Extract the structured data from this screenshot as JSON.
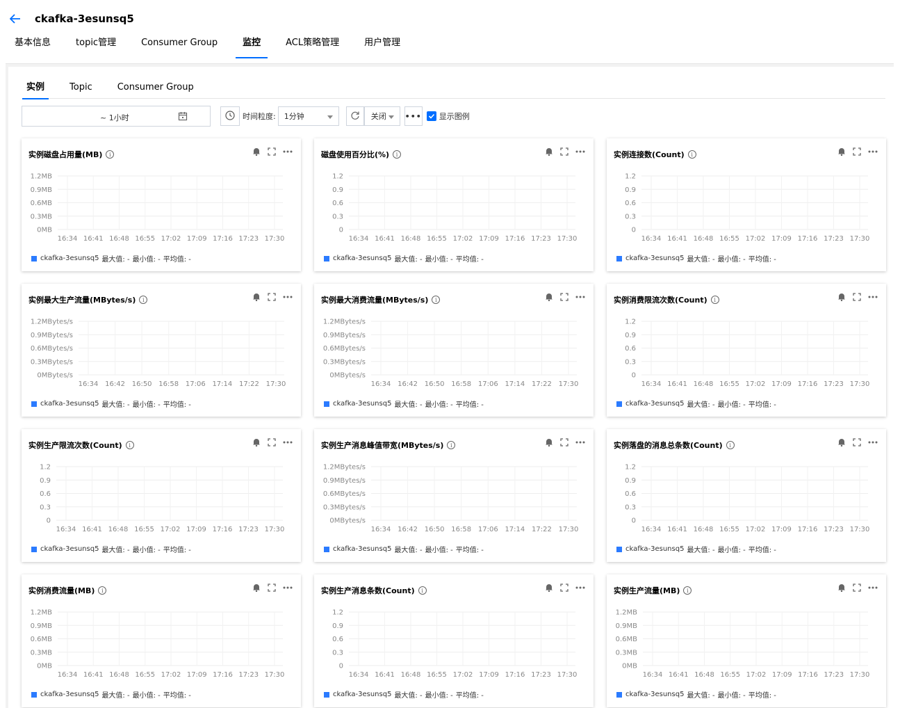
{
  "header": {
    "title": "ckafka-3esunsq5",
    "tabs": [
      "基本信息",
      "topic管理",
      "Consumer Group",
      "监控",
      "ACL策略管理",
      "用户管理"
    ],
    "active_tab": 3
  },
  "sub_tabs": [
    "实例",
    "Topic",
    "Consumer Group"
  ],
  "toolbar": {
    "range_text": "~  1小时",
    "granularity_label": "时间粒度:",
    "granularity_value": "1分钟",
    "refresh_value": "关闭",
    "more": "•••",
    "legend_label": "显示图例"
  },
  "colors": {
    "accent": "#006eff",
    "series": "#2b7bff"
  },
  "legend_stats": {
    "max": "最大值: -",
    "min": "最小值: -",
    "avg": "平均值: -"
  },
  "chart_data": [
    {
      "type": "line",
      "title": "实例磁盘占用量(MB)",
      "y_ticks": [
        "1.2MB",
        "0.9MB",
        "0.6MB",
        "0.3MB",
        "0MB"
      ],
      "x_ticks": [
        "16:34",
        "16:41",
        "16:48",
        "16:55",
        "17:02",
        "17:09",
        "17:16",
        "17:23",
        "17:30"
      ],
      "ylim": [
        0,
        1.2
      ],
      "grid": true,
      "legend": "bottom-left",
      "series": [
        {
          "name": "ckafka-3esunsq5",
          "values": []
        }
      ]
    },
    {
      "type": "line",
      "title": "磁盘使用百分比(%)",
      "y_ticks": [
        "1.2",
        "0.9",
        "0.6",
        "0.3",
        "0"
      ],
      "x_ticks": [
        "16:34",
        "16:41",
        "16:48",
        "16:55",
        "17:02",
        "17:09",
        "17:16",
        "17:23",
        "17:30"
      ],
      "ylim": [
        0,
        1.2
      ],
      "grid": true,
      "legend": "bottom-left",
      "series": [
        {
          "name": "ckafka-3esunsq5",
          "values": []
        }
      ]
    },
    {
      "type": "line",
      "title": "实例连接数(Count)",
      "y_ticks": [
        "1.2",
        "0.9",
        "0.6",
        "0.3",
        "0"
      ],
      "x_ticks": [
        "16:34",
        "16:41",
        "16:48",
        "16:55",
        "17:02",
        "17:09",
        "17:16",
        "17:23",
        "17:30"
      ],
      "ylim": [
        0,
        1.2
      ],
      "grid": true,
      "legend": "bottom-left",
      "series": [
        {
          "name": "ckafka-3esunsq5",
          "values": []
        }
      ]
    },
    {
      "type": "line",
      "title": "实例最大生产流量(MBytes/s)",
      "y_ticks": [
        "1.2MBytes/s",
        "0.9MBytes/s",
        "0.6MBytes/s",
        "0.3MBytes/s",
        "0MBytes/s"
      ],
      "x_ticks": [
        "16:34",
        "16:42",
        "16:50",
        "16:58",
        "17:06",
        "17:14",
        "17:22",
        "17:30"
      ],
      "ylim": [
        0,
        1.2
      ],
      "grid": true,
      "legend": "bottom-left",
      "series": [
        {
          "name": "ckafka-3esunsq5",
          "values": []
        }
      ]
    },
    {
      "type": "line",
      "title": "实例最大消费流量(MBytes/s)",
      "y_ticks": [
        "1.2MBytes/s",
        "0.9MBytes/s",
        "0.6MBytes/s",
        "0.3MBytes/s",
        "0MBytes/s"
      ],
      "x_ticks": [
        "16:34",
        "16:42",
        "16:50",
        "16:58",
        "17:06",
        "17:14",
        "17:22",
        "17:30"
      ],
      "ylim": [
        0,
        1.2
      ],
      "grid": true,
      "legend": "bottom-left",
      "series": [
        {
          "name": "ckafka-3esunsq5",
          "values": []
        }
      ]
    },
    {
      "type": "line",
      "title": "实例消费限流次数(Count)",
      "y_ticks": [
        "1.2",
        "0.9",
        "0.6",
        "0.3",
        "0"
      ],
      "x_ticks": [
        "16:34",
        "16:41",
        "16:48",
        "16:55",
        "17:02",
        "17:09",
        "17:16",
        "17:23",
        "17:30"
      ],
      "ylim": [
        0,
        1.2
      ],
      "grid": true,
      "legend": "bottom-left",
      "series": [
        {
          "name": "ckafka-3esunsq5",
          "values": []
        }
      ]
    },
    {
      "type": "line",
      "title": "实例生产限流次数(Count)",
      "y_ticks": [
        "1.2",
        "0.9",
        "0.6",
        "0.3",
        "0"
      ],
      "x_ticks": [
        "16:34",
        "16:41",
        "16:48",
        "16:55",
        "17:02",
        "17:09",
        "17:16",
        "17:23",
        "17:30"
      ],
      "ylim": [
        0,
        1.2
      ],
      "grid": true,
      "legend": "bottom-left",
      "series": [
        {
          "name": "ckafka-3esunsq5",
          "values": []
        }
      ]
    },
    {
      "type": "line",
      "title": "实例生产消息峰值带宽(MBytes/s)",
      "y_ticks": [
        "1.2MBytes/s",
        "0.9MBytes/s",
        "0.6MBytes/s",
        "0.3MBytes/s",
        "0MBytes/s"
      ],
      "x_ticks": [
        "16:34",
        "16:42",
        "16:50",
        "16:58",
        "17:06",
        "17:14",
        "17:22",
        "17:30"
      ],
      "ylim": [
        0,
        1.2
      ],
      "grid": true,
      "legend": "bottom-left",
      "series": [
        {
          "name": "ckafka-3esunsq5",
          "values": []
        }
      ]
    },
    {
      "type": "line",
      "title": "实例落盘的消息总条数(Count)",
      "y_ticks": [
        "1.2",
        "0.9",
        "0.6",
        "0.3",
        "0"
      ],
      "x_ticks": [
        "16:34",
        "16:41",
        "16:48",
        "16:55",
        "17:02",
        "17:09",
        "17:16",
        "17:23",
        "17:30"
      ],
      "ylim": [
        0,
        1.2
      ],
      "grid": true,
      "legend": "bottom-left",
      "series": [
        {
          "name": "ckafka-3esunsq5",
          "values": []
        }
      ]
    },
    {
      "type": "line",
      "title": "实例消费流量(MB)",
      "y_ticks": [
        "1.2MB",
        "0.9MB",
        "0.6MB",
        "0.3MB",
        "0MB"
      ],
      "x_ticks": [
        "16:34",
        "16:41",
        "16:48",
        "16:55",
        "17:02",
        "17:09",
        "17:16",
        "17:23",
        "17:30"
      ],
      "ylim": [
        0,
        1.2
      ],
      "grid": true,
      "legend": "bottom-left",
      "series": [
        {
          "name": "ckafka-3esunsq5",
          "values": []
        }
      ]
    },
    {
      "type": "line",
      "title": "实例生产消息条数(Count)",
      "y_ticks": [
        "1.2",
        "0.9",
        "0.6",
        "0.3",
        "0"
      ],
      "x_ticks": [
        "16:34",
        "16:41",
        "16:48",
        "16:55",
        "17:02",
        "17:09",
        "17:16",
        "17:23",
        "17:30"
      ],
      "ylim": [
        0,
        1.2
      ],
      "grid": true,
      "legend": "bottom-left",
      "series": [
        {
          "name": "ckafka-3esunsq5",
          "values": []
        }
      ]
    },
    {
      "type": "line",
      "title": "实例生产流量(MB)",
      "y_ticks": [
        "1.2MB",
        "0.9MB",
        "0.6MB",
        "0.3MB",
        "0MB"
      ],
      "x_ticks": [
        "16:34",
        "16:41",
        "16:48",
        "16:55",
        "17:02",
        "17:09",
        "17:16",
        "17:23",
        "17:30"
      ],
      "ylim": [
        0,
        1.2
      ],
      "grid": true,
      "legend": "bottom-left",
      "series": [
        {
          "name": "ckafka-3esunsq5",
          "values": []
        }
      ]
    }
  ]
}
